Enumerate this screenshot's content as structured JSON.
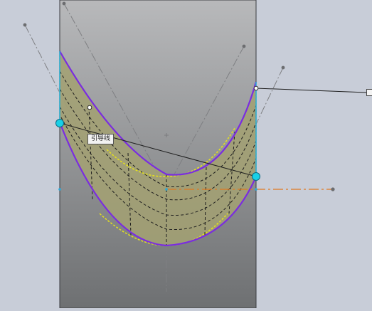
{
  "viewport": {
    "background_color": "#c8cdd8",
    "part_gradient_colors": [
      "#b6b7b9",
      "#707274"
    ]
  },
  "surface": {
    "fill_color": "#a3a073",
    "edge_color": "#7a2ce0",
    "section_color": "#222222",
    "highlight_color": "#e6e21c"
  },
  "annotations": {
    "leader_label": "引导线",
    "handle_color": "#19d0e6"
  }
}
